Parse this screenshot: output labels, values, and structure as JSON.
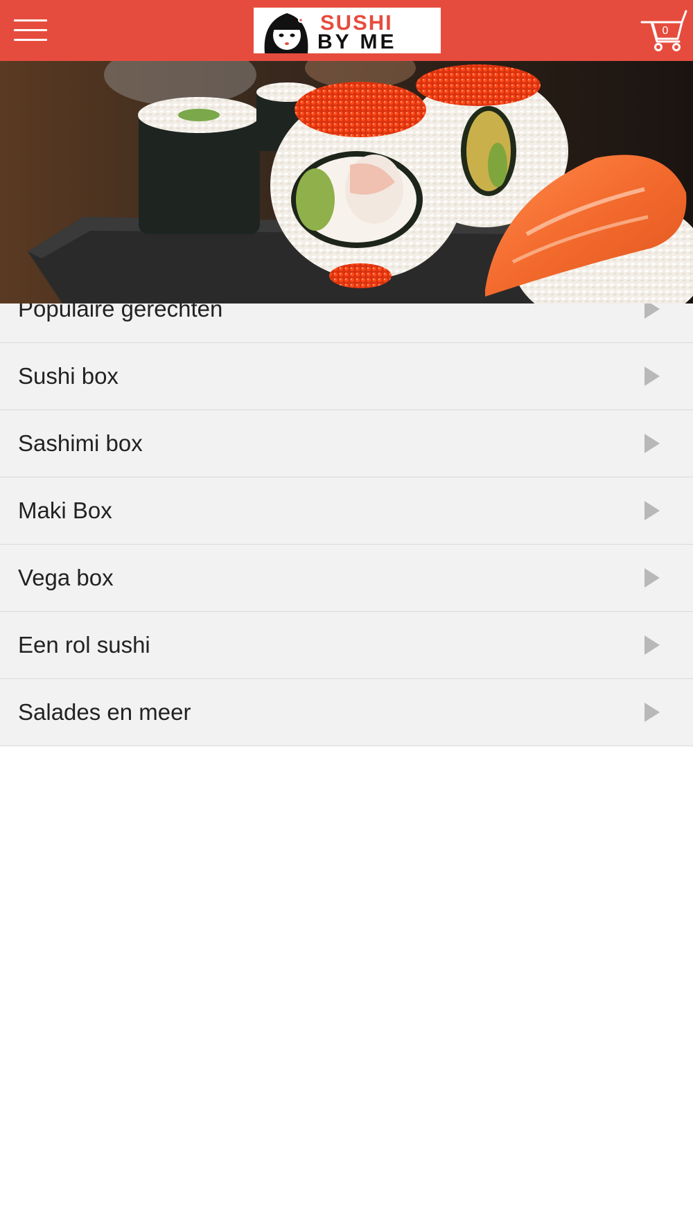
{
  "header": {
    "brand": {
      "line1": "SUSHI",
      "line2": "BY ME"
    },
    "menu_icon": "hamburger-menu-icon",
    "cart": {
      "icon": "shopping-cart-icon",
      "count": "0"
    },
    "colors": {
      "bar": "#e64c3e",
      "brand_red": "#e64c3e"
    }
  },
  "hero": {
    "subject": "sushi-photo"
  },
  "categories": [
    {
      "label": "Populaire gerechten"
    },
    {
      "label": "Sushi box"
    },
    {
      "label": "Sashimi box"
    },
    {
      "label": "Maki Box"
    },
    {
      "label": "Vega box"
    },
    {
      "label": "Een rol sushi"
    },
    {
      "label": "Salades en meer"
    }
  ],
  "list_chevron_icon": "chevron-right-icon"
}
